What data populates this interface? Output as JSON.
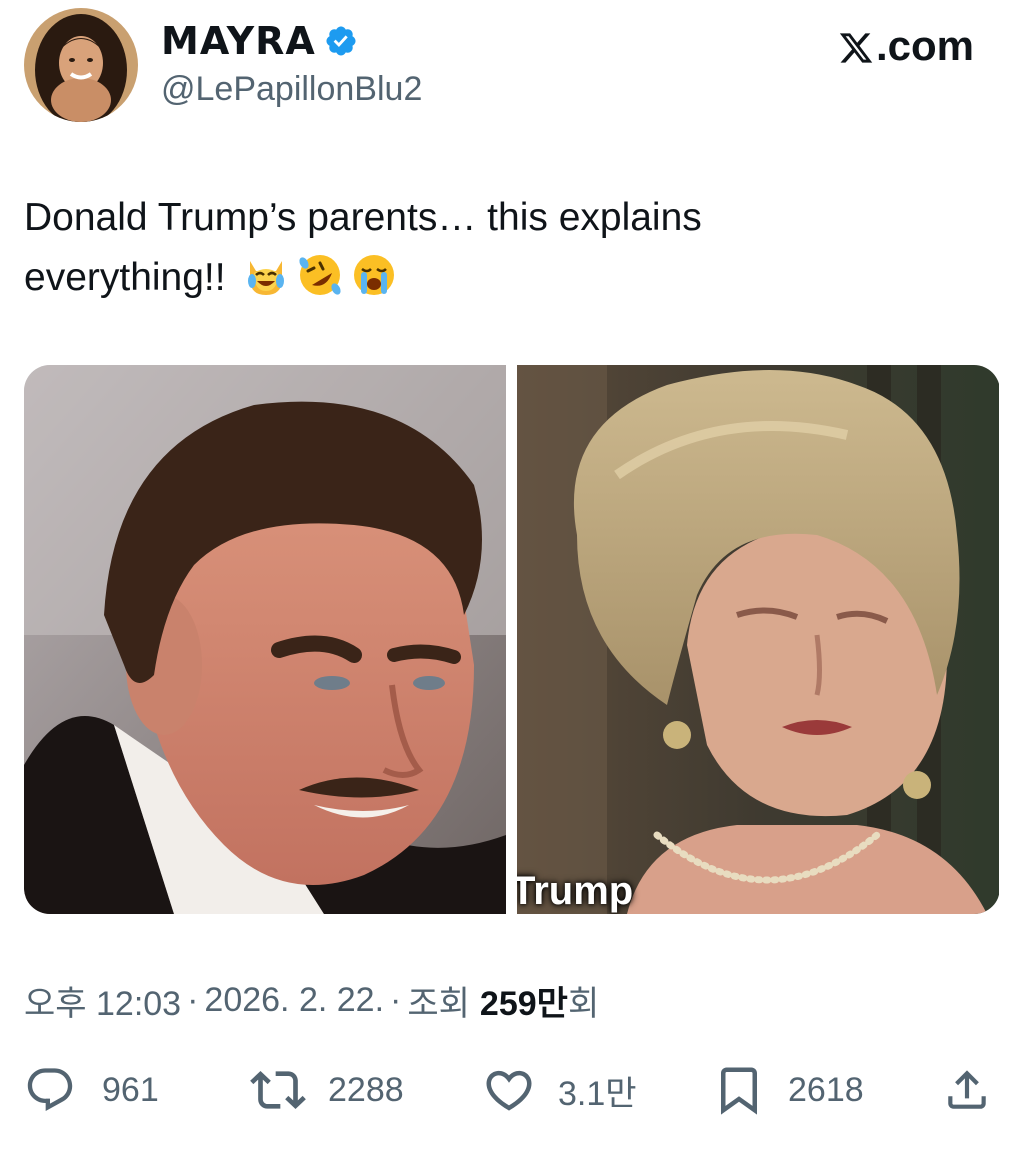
{
  "author": {
    "display_name": "MAYRA",
    "handle": "@LePapillonBlu2",
    "avatar_icon": "profile-photo",
    "verified_color": "#1d9bf0"
  },
  "site": {
    "label": ".com",
    "logo_icon": "x-logo-icon"
  },
  "tweet": {
    "line1": "Donald Trump’s parents… this explains",
    "line2": "everything!!",
    "emojis": [
      "cat-tears-of-joy-emoji",
      "rolling-on-floor-laughing-emoji",
      "loudly-crying-emoji"
    ]
  },
  "media": {
    "photo_right_caption": "Trump"
  },
  "meta": {
    "time": "오후 12:03",
    "dot": "·",
    "date": "2026. 2. 22.",
    "views_label": "조회",
    "views_count": "259만",
    "views_suffix": "회"
  },
  "actions": {
    "replies": "961",
    "reposts": "2288",
    "likes": "3.1만",
    "bookmarks": "2618",
    "reply_icon": "reply-icon",
    "repost_icon": "repost-icon",
    "like_icon": "heart-icon",
    "bookmark_icon": "bookmark-icon",
    "share_icon": "share-icon"
  },
  "colors": {
    "text_primary": "#0f1419",
    "text_secondary": "#536471",
    "accent": "#1d9bf0"
  }
}
